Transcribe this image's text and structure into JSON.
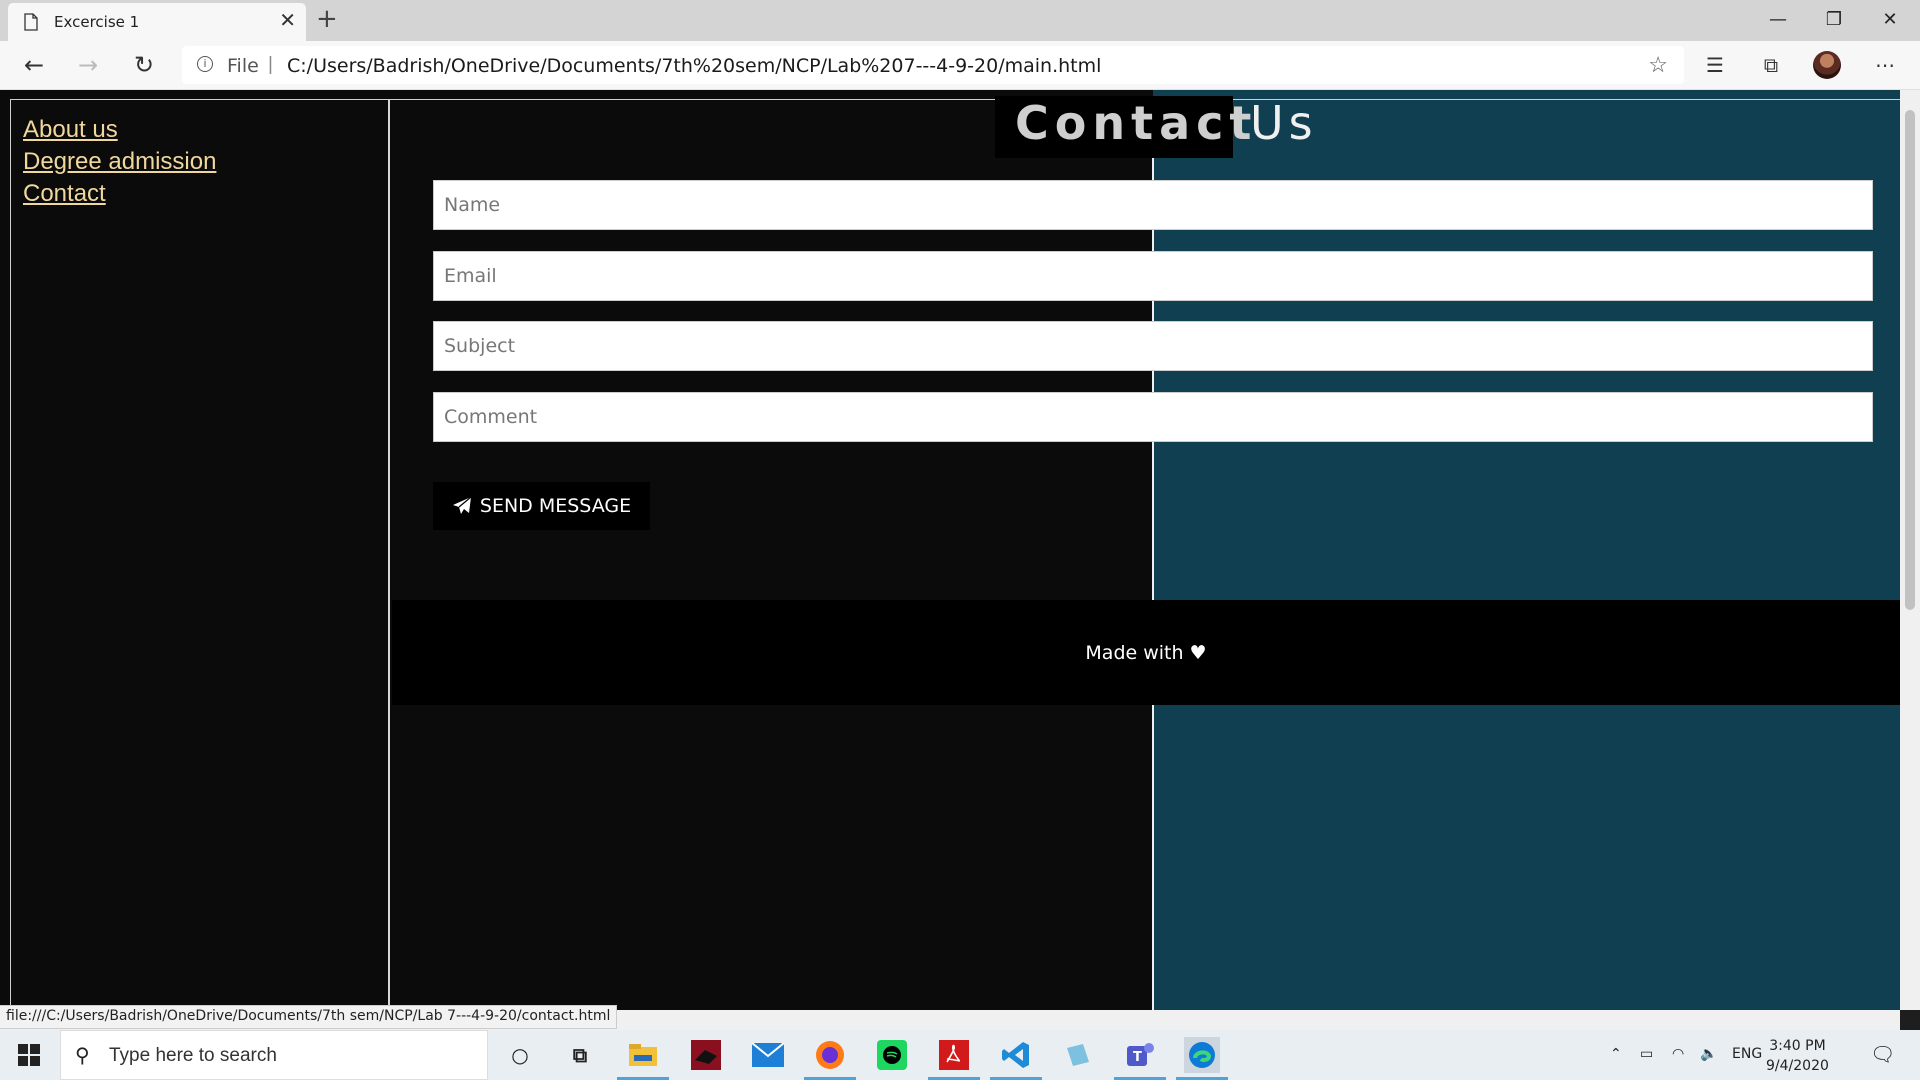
{
  "browser": {
    "tab_title": "Excercise 1",
    "url_scheme": "File",
    "url": "C:/Users/Badrish/OneDrive/Documents/7th%20sem/NCP/Lab%207---4-9-20/main.html",
    "status_url": "file:///C:/Users/Badrish/OneDrive/Documents/7th sem/NCP/Lab 7---4-9-20/contact.html"
  },
  "sidebar": {
    "items": [
      {
        "label": "About us"
      },
      {
        "label": "Degree admission"
      },
      {
        "label": "Contact"
      }
    ]
  },
  "contact": {
    "heading_part1": "Contact",
    "heading_part2": "Us",
    "name_placeholder": "Name",
    "email_placeholder": "Email",
    "subject_placeholder": "Subject",
    "comment_placeholder": "Comment",
    "send_label": "SEND MESSAGE"
  },
  "footer": {
    "text": "Made with"
  },
  "taskbar": {
    "search_placeholder": "Type here to search",
    "language": "ENG",
    "time": "3:40 PM",
    "date": "9/4/2020"
  },
  "colors": {
    "link": "#f0d79c",
    "panel_right": "#113f52",
    "panel_left": "#0b0b0b"
  }
}
